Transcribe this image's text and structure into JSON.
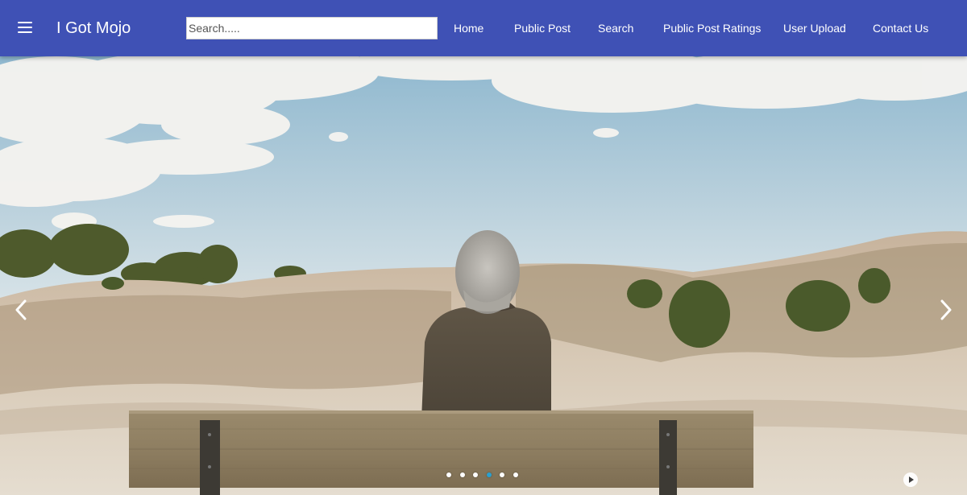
{
  "navbar": {
    "menu_icon": "hamburger-menu-icon",
    "brand": "I Got Mojo",
    "search": {
      "placeholder": "Search.....",
      "value": ""
    },
    "links": [
      "Home",
      "Public Post",
      "Search",
      "Public Post Ratings",
      "User Upload",
      "Contact Us"
    ],
    "background_color": "#3f51b5"
  },
  "carousel": {
    "image_alt": "Person with gray hair sitting on a wooden bench facing sand dunes under a cloudy blue sky",
    "prev_icon": "chevron-left-icon",
    "next_icon": "chevron-right-icon",
    "slide_count": 6,
    "active_slide": 4,
    "play_icon": "play-circle-icon",
    "indicator_active_color": "#2aa0cf"
  }
}
